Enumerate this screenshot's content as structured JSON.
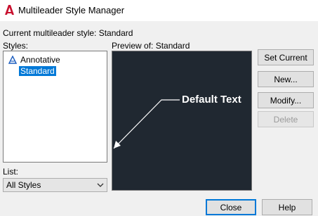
{
  "window": {
    "title": "Multileader Style Manager"
  },
  "current_style": {
    "label": "Current multileader style: Standard"
  },
  "styles": {
    "label": "Styles:",
    "items": [
      {
        "label": "Annotative",
        "icon": "annotative-icon",
        "selected": false
      },
      {
        "label": "Standard",
        "selected": true
      }
    ]
  },
  "list_filter": {
    "label": "List:",
    "value": "All Styles"
  },
  "preview": {
    "label": "Preview of: Standard",
    "text": "Default Text"
  },
  "buttons": {
    "set_current": "Set Current",
    "new": "New...",
    "modify": "Modify...",
    "delete": "Delete",
    "close": "Close",
    "help": "Help"
  },
  "colors": {
    "selection": "#0078d7",
    "preview_background": "#202831",
    "app_icon": "#c8102e"
  }
}
